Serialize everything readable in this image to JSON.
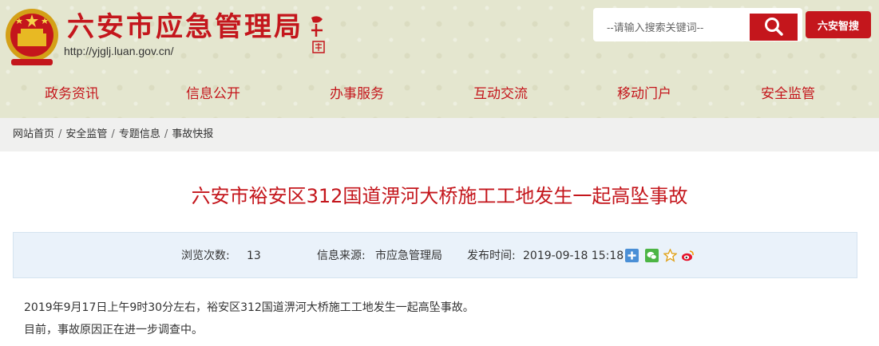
{
  "header": {
    "site_title": "六安市应急管理局",
    "site_url": "http://yjglj.luan.gov.cn/",
    "search_placeholder": "--请输入搜索关键词--",
    "zhiso_label": "六安智搜"
  },
  "nav": {
    "items": [
      {
        "label": "政务资讯"
      },
      {
        "label": "信息公开"
      },
      {
        "label": "办事服务"
      },
      {
        "label": "互动交流"
      },
      {
        "label": "移动门户"
      },
      {
        "label": "安全监管"
      }
    ]
  },
  "breadcrumb": {
    "items": [
      "网站首页",
      "安全监管",
      "专题信息",
      "事故快报"
    ],
    "separator": "/"
  },
  "article": {
    "title": "六安市裕安区312国道淠河大桥施工工地发生一起高坠事故",
    "meta": {
      "views_label": "浏览次数:",
      "views_value": "13",
      "source_label": "信息来源:",
      "source_value": "市应急管理局",
      "time_label": "发布时间:",
      "time_value": "2019-09-18 15:18"
    },
    "paragraphs": [
      "2019年9月17日上午9时30分左右，裕安区312国道淠河大桥施工工地发生一起高坠事故。",
      "目前，事故原因正在进一步调查中。"
    ]
  },
  "share_icons": [
    "plus-share-icon",
    "wechat-icon",
    "star-icon",
    "weibo-icon"
  ],
  "colors": {
    "brand_red": "#c4161c",
    "header_bg": "#e4e6cf",
    "breadcrumb_bg": "#f0f0ef",
    "meta_bg": "#eaf2fa"
  }
}
